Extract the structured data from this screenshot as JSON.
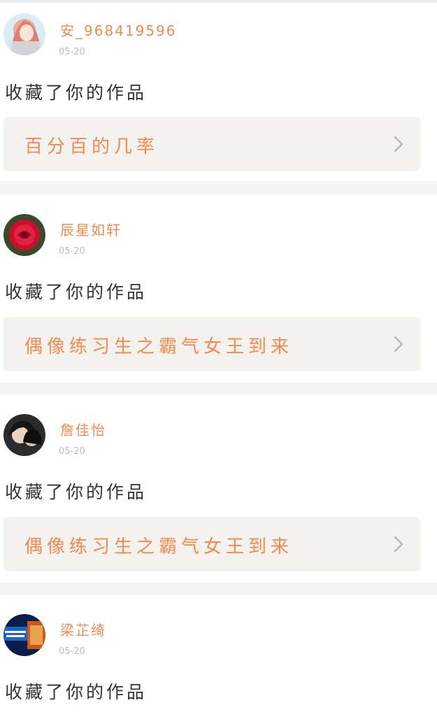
{
  "colors": {
    "accent": "#f08a4f",
    "card_bg": "#f3f2ee",
    "timestamp": "#bdbdbd",
    "body_text": "#333333"
  },
  "feed": {
    "items": [
      {
        "username": "安_968419596",
        "time": "05-20",
        "action": "收藏了你的作品",
        "work_title": "百分百的几率",
        "avatar": "anime-girl-avatar",
        "chevron": "chevron-right-icon"
      },
      {
        "username": "辰星如轩",
        "time": "05-20",
        "action": "收藏了你的作品",
        "work_title": "偶像练习生之霸气女王到来",
        "avatar": "red-rose-avatar",
        "chevron": "chevron-right-icon"
      },
      {
        "username": "詹佳怡",
        "time": "05-20",
        "action": "收藏了你的作品",
        "work_title": "偶像练习生之霸气女王到来",
        "avatar": "dark-couple-avatar",
        "chevron": "chevron-right-icon"
      },
      {
        "username": "梁芷绮",
        "time": "05-20",
        "action": "收藏了你的作品",
        "avatar": "blue-poster-avatar"
      }
    ]
  }
}
